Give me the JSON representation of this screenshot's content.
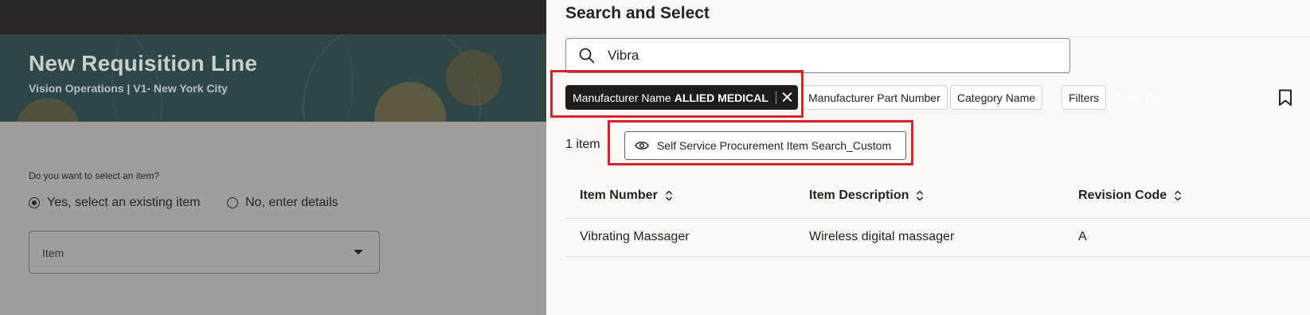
{
  "background_page": {
    "title": "New Requisition Line",
    "subtitle": "Vision Operations | V1- New York City",
    "question": "Do you want to select an item?",
    "radio_options": [
      {
        "label": "Yes, select an existing item",
        "selected": true
      },
      {
        "label": "No, enter details",
        "selected": false
      }
    ],
    "item_select_label": "Item"
  },
  "drawer": {
    "title": "Search and Select",
    "search_value": "Vibra",
    "filters": {
      "manufacturer_label": "Manufacturer Name",
      "manufacturer_value": "ALLIED MEDICAL",
      "chips": [
        "Manufacturer Part Number",
        "Category Name",
        "Filters"
      ],
      "clear_label": "Clear (1)"
    },
    "result_count": "1 item",
    "saved_search": "Self Service Procurement Item Search_Custom",
    "table": {
      "columns": [
        "Item Number",
        "Item Description",
        "Revision Code"
      ],
      "rows": [
        [
          "Vibrating Massager",
          "Wireless digital massager",
          "A"
        ]
      ]
    }
  },
  "colors": {
    "highlight": "#d9222a",
    "active_chip": "#1f1d1b",
    "banner": "#2f4647",
    "overlay": "#a19d9a"
  },
  "icons": [
    "search-icon",
    "close-icon",
    "bookmark-icon",
    "eye-icon",
    "sort-icon"
  ]
}
